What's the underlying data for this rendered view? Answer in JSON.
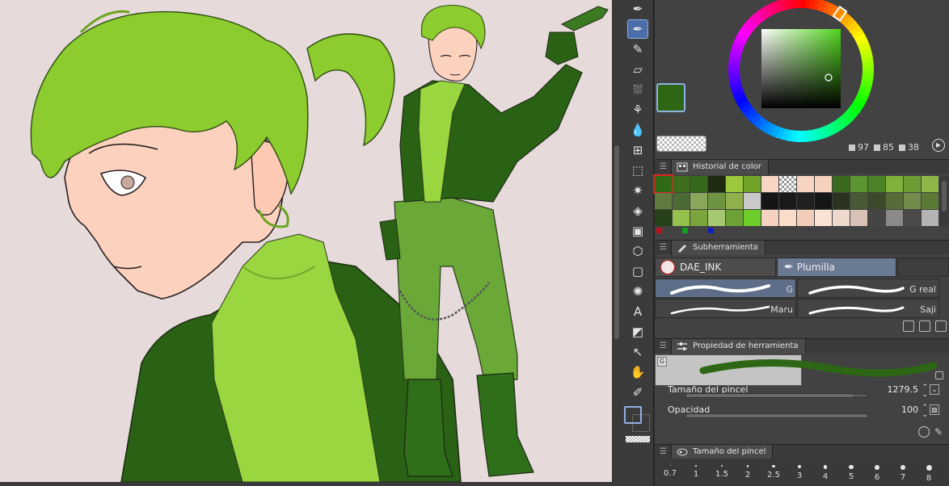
{
  "color": {
    "main": "#2d6715",
    "sub": "#454545",
    "hsv": [
      {
        "key": "h",
        "value": "97"
      },
      {
        "key": "s",
        "value": "85"
      },
      {
        "key": "v",
        "value": "38"
      }
    ]
  },
  "panels": {
    "color_history": {
      "title": "Historial de color",
      "rows": [
        [
          "#2f6b16",
          "#3e6d20",
          "#36681c",
          "#1e2a12",
          "#9cc83c",
          "#6fa428",
          "#f8d6c4",
          "checker",
          "#f7d4c1",
          "#f6d1be",
          "#3a6a1c",
          "#5c9630",
          "#4a8426",
          "#7fb23a",
          "#6e9c34",
          "#90b64a"
        ],
        [
          "#5f7c3e",
          "#4e6a34",
          "#8aa85c",
          "#6e9442",
          "#8fb04a",
          "#c9c9c9",
          "#151515",
          "#1a1a1a",
          "#202020",
          "#161616",
          "#2a3320",
          "#4a5a36",
          "#3c4a2c",
          "#556b38",
          "#728c4c",
          "#5b7a36"
        ],
        [
          "#26401a",
          "#94c04c",
          "#7aa43c",
          "#a6c870",
          "#6ea038",
          "#6ccc28",
          "#f5d2bf",
          "#fbdccb",
          "#f2cdb9",
          "#f9e3d4",
          "#eed9cd",
          "#d9c3b8",
          "#454545",
          "#8a8a8a",
          "#4a4a4a",
          "#b4b4b4"
        ]
      ],
      "dots": [
        "#c0101a",
        "#10a020",
        "#1020c0"
      ]
    },
    "subtool": {
      "title": "Subherramienta",
      "groups": [
        {
          "label": "DAE_INK",
          "active": false
        },
        {
          "label": "Plumilla",
          "active": true
        }
      ],
      "brushes": [
        {
          "label": "G",
          "active": true
        },
        {
          "label": "G real",
          "active": false
        },
        {
          "label": "Maru",
          "active": false
        },
        {
          "label": "Saji",
          "active": false
        }
      ]
    },
    "tool_property": {
      "title": "Propiedad de herramienta",
      "tag": "G",
      "brush_size": {
        "label": "Tamaño del pincel",
        "value": "1279.5",
        "fill": 0.92
      },
      "opacity": {
        "label": "Opacidad",
        "value": "100",
        "fill": 1.0
      }
    },
    "brush_size": {
      "title": "Tamaño del pincel",
      "sizes": [
        "0.7",
        "1",
        "1.5",
        "2",
        "2.5",
        "3",
        "4",
        "5",
        "6",
        "7",
        "8"
      ]
    }
  },
  "tools": [
    {
      "name": "pen-tool-icon",
      "glyph": "✒"
    },
    {
      "name": "pen-tool-active-icon",
      "glyph": "✒",
      "active": true
    },
    {
      "name": "pencil-tool-icon",
      "glyph": "✎"
    },
    {
      "name": "eraser-tool-icon",
      "glyph": "▱"
    },
    {
      "name": "airbrush-tool-icon",
      "glyph": "⛆"
    },
    {
      "name": "decoration-tool-icon",
      "glyph": "⚘"
    },
    {
      "name": "blend-tool-icon",
      "glyph": "💧"
    },
    {
      "name": "grid-tool-icon",
      "glyph": "⊞"
    },
    {
      "name": "selection-tool-icon",
      "glyph": "⬚"
    },
    {
      "name": "auto-select-tool-icon",
      "glyph": "✷"
    },
    {
      "name": "fill-tool-icon",
      "glyph": "◈"
    },
    {
      "name": "gradient-tool-icon",
      "glyph": "▣"
    },
    {
      "name": "3d-tool-icon",
      "glyph": "⬡"
    },
    {
      "name": "figure-tool-icon",
      "glyph": "▢"
    },
    {
      "name": "ruler-tool-icon",
      "glyph": "✺"
    },
    {
      "name": "text-tool-icon",
      "glyph": "A"
    },
    {
      "name": "frame-tool-icon",
      "glyph": "◩"
    },
    {
      "name": "object-tool-icon",
      "glyph": "↖"
    },
    {
      "name": "hand-tool-icon",
      "glyph": "✋"
    },
    {
      "name": "eyedropper-tool-icon",
      "glyph": "✐"
    }
  ]
}
